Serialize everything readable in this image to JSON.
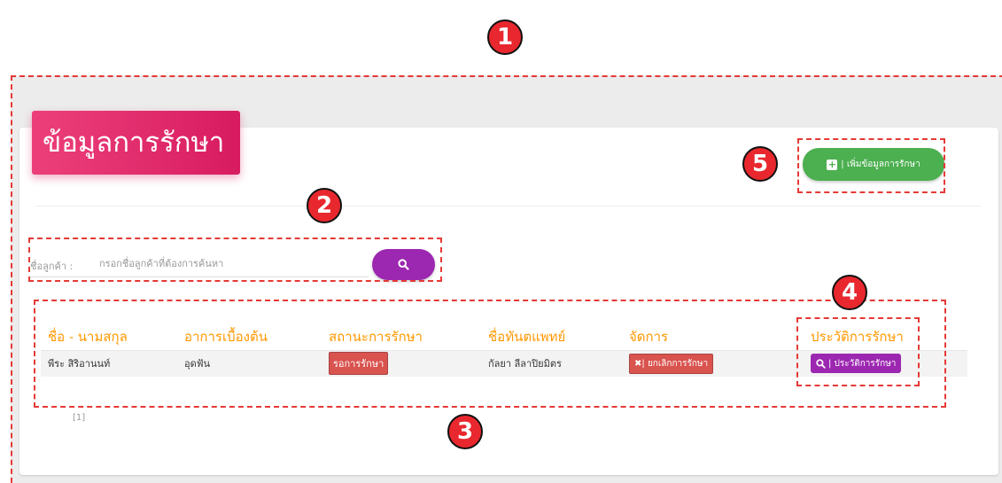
{
  "page_title": "ข้อมูลการรักษา",
  "add_button": {
    "label": "| เพิ่มข้อมูลการรักษา",
    "icon": "plus-square-icon"
  },
  "search": {
    "label": "ชื่อลูกค้า :",
    "placeholder": "กรอกชื่อลูกค้าที่ต้องการค้นหา",
    "button_icon": "search-icon"
  },
  "table": {
    "headers": [
      "ชื่อ - นามสกุล",
      "อาการเบื้องต้น",
      "สถานะการรักษา",
      "ชื่อทันตแพทย์",
      "จัดการ",
      "ประวัติการรักษา"
    ],
    "rows": [
      {
        "name": "พีระ   สิริอานนท์",
        "symptom": "อุดฟัน",
        "status": "รอการรักษา",
        "dentist": "กัลยา ลีลาปิยมิตร",
        "manage": "| ยกเลิกการรักษา",
        "history": "| ประวัติการรักษา"
      }
    ]
  },
  "pagination": "[1]",
  "markers": [
    "1",
    "2",
    "3",
    "4",
    "5"
  ],
  "colors": {
    "title": "#d81b60",
    "add": "#4caf50",
    "search": "#9c27b0",
    "header": "#ff9800",
    "danger": "#d9534f",
    "marker": "#e8282e"
  }
}
